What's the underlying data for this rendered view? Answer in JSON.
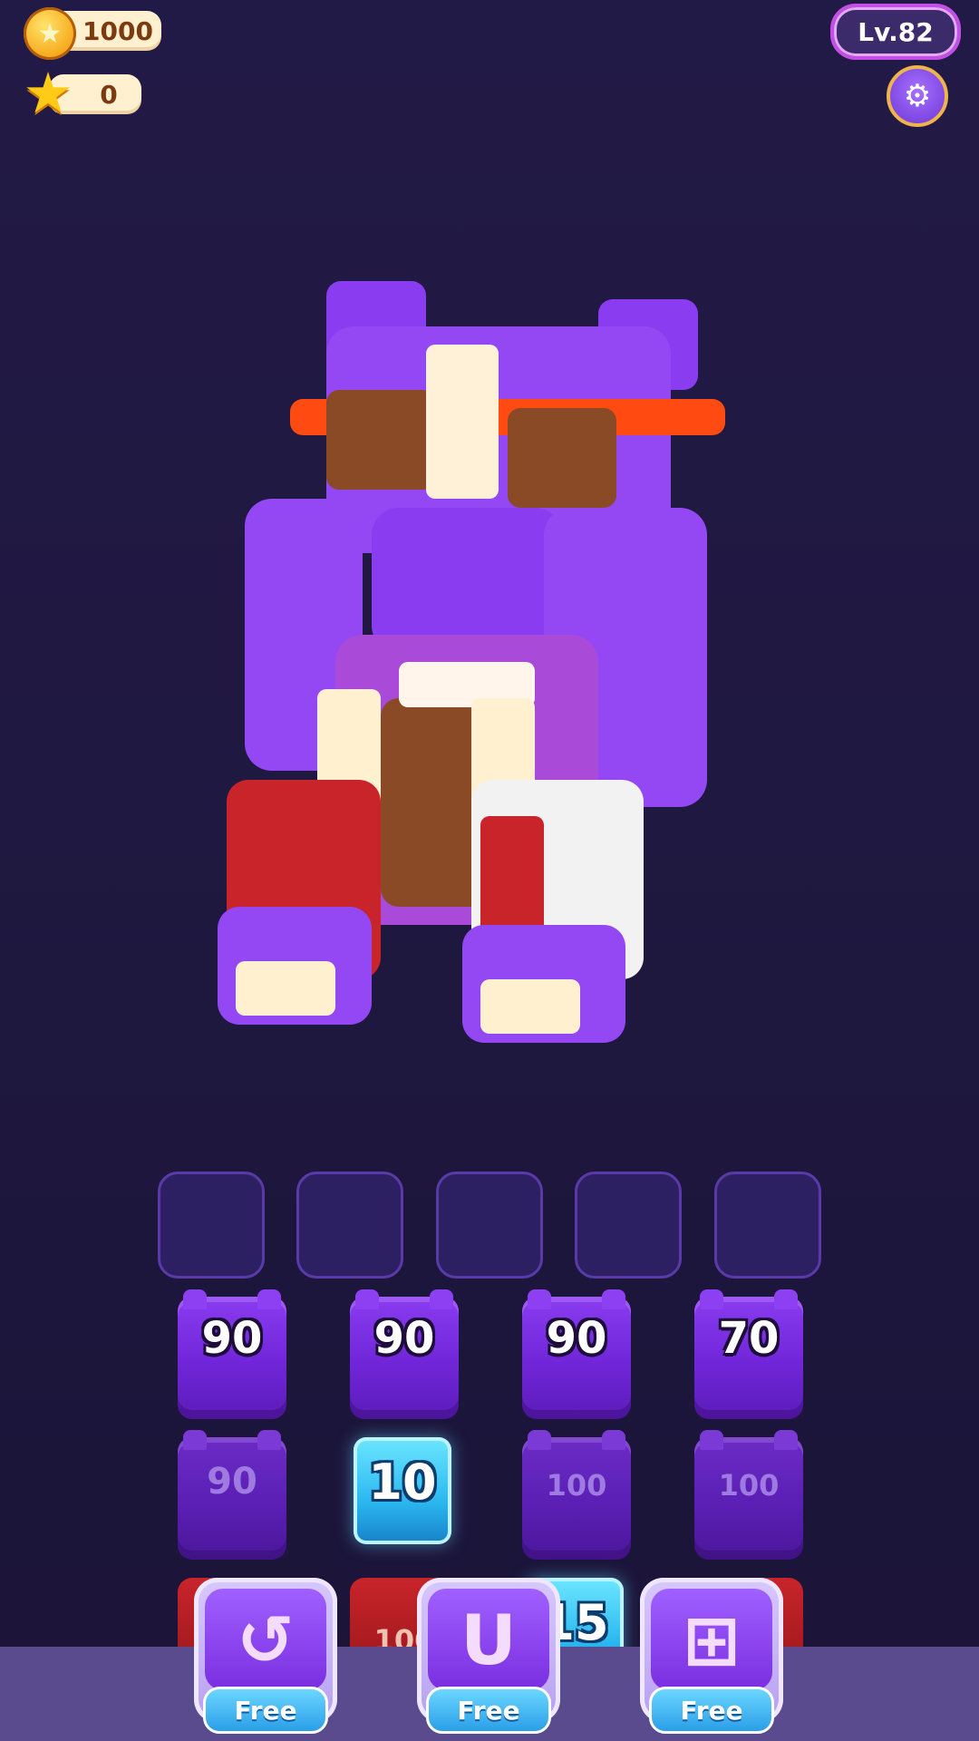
{
  "hud": {
    "coins": "1000",
    "stars": "0",
    "level": "Lv.82",
    "coin_icon": "coin-icon",
    "star_icon": "star-icon",
    "settings_icon": "gear-icon"
  },
  "slots": [
    {},
    {},
    {},
    {},
    {}
  ],
  "blocks": {
    "row1": [
      "90",
      "90",
      "90",
      "70"
    ],
    "row2": [
      "90",
      "10",
      "100",
      "100"
    ],
    "row3_partial": [
      "100",
      "15"
    ]
  },
  "boosters": [
    {
      "icon": "undo-icon",
      "label": "Free"
    },
    {
      "icon": "magnet-icon",
      "label": "Free"
    },
    {
      "icon": "add-slot-icon",
      "label": "Free"
    }
  ],
  "colors": {
    "block_purple": "#7a2ee0",
    "ice_blue": "#2bb8f0",
    "red_block": "#c8242a",
    "background": "#221a46"
  }
}
